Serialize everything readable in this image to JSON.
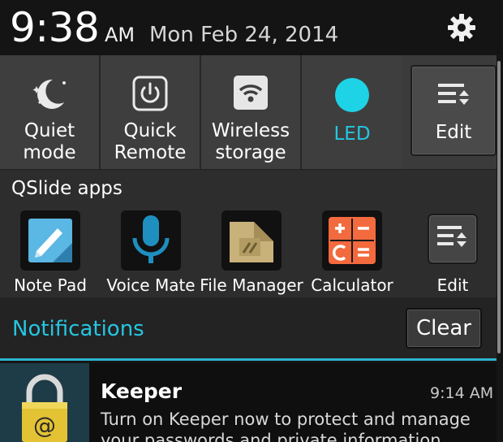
{
  "status": {
    "time": "9:38",
    "ampm": "AM",
    "date": "Mon Feb 24, 2014",
    "settings_icon": "gear-icon"
  },
  "quick_settings": {
    "tiles": [
      {
        "label": "Quiet\nmode",
        "icon": "moon-stars-icon"
      },
      {
        "label": "Quick\nRemote",
        "icon": "power-icon"
      },
      {
        "label": "Wireless\nstorage",
        "icon": "wifi-icon"
      },
      {
        "label": "LED",
        "icon": "led-circle-icon",
        "active_color": "#25c6e2"
      }
    ],
    "edit_label": "Edit"
  },
  "qslide": {
    "title": "QSlide apps",
    "apps": [
      {
        "label": "Note Pad",
        "icon": "notepad-icon"
      },
      {
        "label": "Voice Mate",
        "icon": "microphone-icon"
      },
      {
        "label": "File Manager",
        "icon": "folder-icon"
      },
      {
        "label": "Calculator",
        "icon": "calculator-icon"
      }
    ],
    "edit_label": "Edit"
  },
  "notifications": {
    "title": "Notifications",
    "clear_label": "Clear",
    "items": [
      {
        "app": "Keeper",
        "time": "9:14 AM",
        "text": "Turn on Keeper now to protect and manage your passwords and private information",
        "icon": "padlock-icon"
      }
    ]
  },
  "colors": {
    "accent": "#25c6e2",
    "calculator": "#f26a3d",
    "notepad": "#4aa9d8",
    "mic": "#1f8fc0",
    "folder": "#c9b27a",
    "padlock": "#e3c233"
  }
}
